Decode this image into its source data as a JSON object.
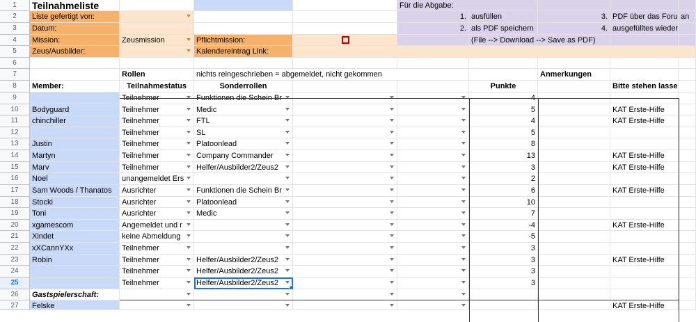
{
  "colors": {
    "orange_label": "#f6b26b",
    "orange_light": "#fce5cd",
    "purple": "#d9d2e9",
    "blue_member": "#c9daf8",
    "col_b_top": "#c9daf8"
  },
  "header_area": {
    "title": "Teilnahmeliste",
    "labels": [
      "Liste gefertigt von:",
      "Datum:",
      "Mission:",
      "Zeus/Ausbilder:"
    ],
    "mission_value": "Zeusmission",
    "pflichtmission_label": "Pflichtmission:",
    "kalender_label": "Kalendereintrag Link:",
    "abgabe_title": "Für die Abgabe:",
    "abgabe": [
      {
        "num": "1.",
        "text": "ausfüllen",
        "num2": "3.",
        "text2": "PDF über das Forum",
        "tail": "an"
      },
      {
        "num": "2.",
        "text": "als PDF speichern",
        "num2": "4.",
        "text2": "ausgefülltes wieder lösc",
        "tail": ""
      },
      {
        "num": "",
        "text": "(File --> Download --> Save as PDF)",
        "num2": "",
        "text2": "",
        "tail": ""
      }
    ]
  },
  "notes": {
    "rollen": "Rollen",
    "note": "nichts reingeschrieben = abgemeldet, nicht gekommen",
    "anmerkungen": "Anmerkungen"
  },
  "headers": {
    "member": "Member:",
    "status": "Teilnahmestatus",
    "sonder": "Sonderrollen",
    "punkte": "Punkte",
    "bitte": "Bitte stehen lassen!"
  },
  "row_numbers": [
    "1",
    "2",
    "3",
    "4",
    "5",
    "6",
    "7",
    "8",
    "9",
    "10",
    "11",
    "12",
    "13",
    "14",
    "15",
    "16",
    "17",
    "18",
    "19",
    "20",
    "21",
    "22",
    "23",
    "24",
    "25",
    "26",
    "27"
  ],
  "members": [
    {
      "num": "9",
      "name": "",
      "status": "Teilnehmer",
      "sonder": "Funktionen die Schein Br",
      "punkte": "4",
      "note": ""
    },
    {
      "num": "10",
      "name": "Bodyguard",
      "status": "Teilnehmer",
      "sonder": "Medic",
      "punkte": "5",
      "note": "KAT Erste-Hilfe"
    },
    {
      "num": "11",
      "name": "chinchiller",
      "status": "Teilnehmer",
      "sonder": "FTL",
      "punkte": "4",
      "note": "KAT Erste-Hilfe"
    },
    {
      "num": "12",
      "name": "",
      "status": "Teilnehmer",
      "sonder": "SL",
      "punkte": "5",
      "note": ""
    },
    {
      "num": "13",
      "name": "Justin",
      "status": "Teilnehmer",
      "sonder": "Platoonlead",
      "punkte": "8",
      "note": ""
    },
    {
      "num": "14",
      "name": "Martyn",
      "status": "Teilnehmer",
      "sonder": "Company Commander",
      "punkte": "13",
      "note": "KAT Erste-Hilfe"
    },
    {
      "num": "15",
      "name": "Marv",
      "status": "Teilnehmer",
      "sonder": "Helfer/Ausbilder2/Zeus2",
      "punkte": "3",
      "note": "KAT Erste-Hilfe"
    },
    {
      "num": "16",
      "name": "Noel",
      "status": "unangemeldet Ers",
      "sonder": "",
      "punkte": "2",
      "note": ""
    },
    {
      "num": "17",
      "name": "Sam Woods / Thanatos",
      "status": "Ausrichter",
      "sonder": "Funktionen die Schein Br",
      "punkte": "6",
      "note": "KAT Erste-Hilfe"
    },
    {
      "num": "18",
      "name": "Stocki",
      "status": "Ausrichter",
      "sonder": "Platoonlead",
      "punkte": "10",
      "note": ""
    },
    {
      "num": "19",
      "name": "Toni",
      "status": "Ausrichter",
      "sonder": "Medic",
      "punkte": "7",
      "note": ""
    },
    {
      "num": "20",
      "name": "xgamescom",
      "status": "Angemeldet und r",
      "sonder": "",
      "punkte": "-4",
      "note": "KAT Erste-Hilfe"
    },
    {
      "num": "21",
      "name": "Xindet",
      "status": "keine Abmeldung",
      "sonder": "",
      "punkte": "-5",
      "note": ""
    },
    {
      "num": "22",
      "name": "xXCannYXx",
      "status": "Teilnehmer",
      "sonder": "",
      "punkte": "3",
      "note": ""
    },
    {
      "num": "23",
      "name": "Robin",
      "status": "Teilnehmer",
      "sonder": "Helfer/Ausbilder2/Zeus2",
      "punkte": "3",
      "note": "KAT Erste-Hilfe"
    },
    {
      "num": "24",
      "name": "",
      "status": "Teilnehmer",
      "sonder": "Helfer/Ausbilder2/Zeus2",
      "punkte": "3",
      "note": ""
    },
    {
      "num": "25",
      "name": "",
      "status": "Teilnehmer",
      "sonder": "Helfer/Ausbilder2/Zeus2",
      "punkte": "3",
      "note": ""
    }
  ],
  "gast": {
    "label": "Gastspielerschaft:",
    "name27": "Felske",
    "note27": "KAT Erste-Hilfe"
  }
}
